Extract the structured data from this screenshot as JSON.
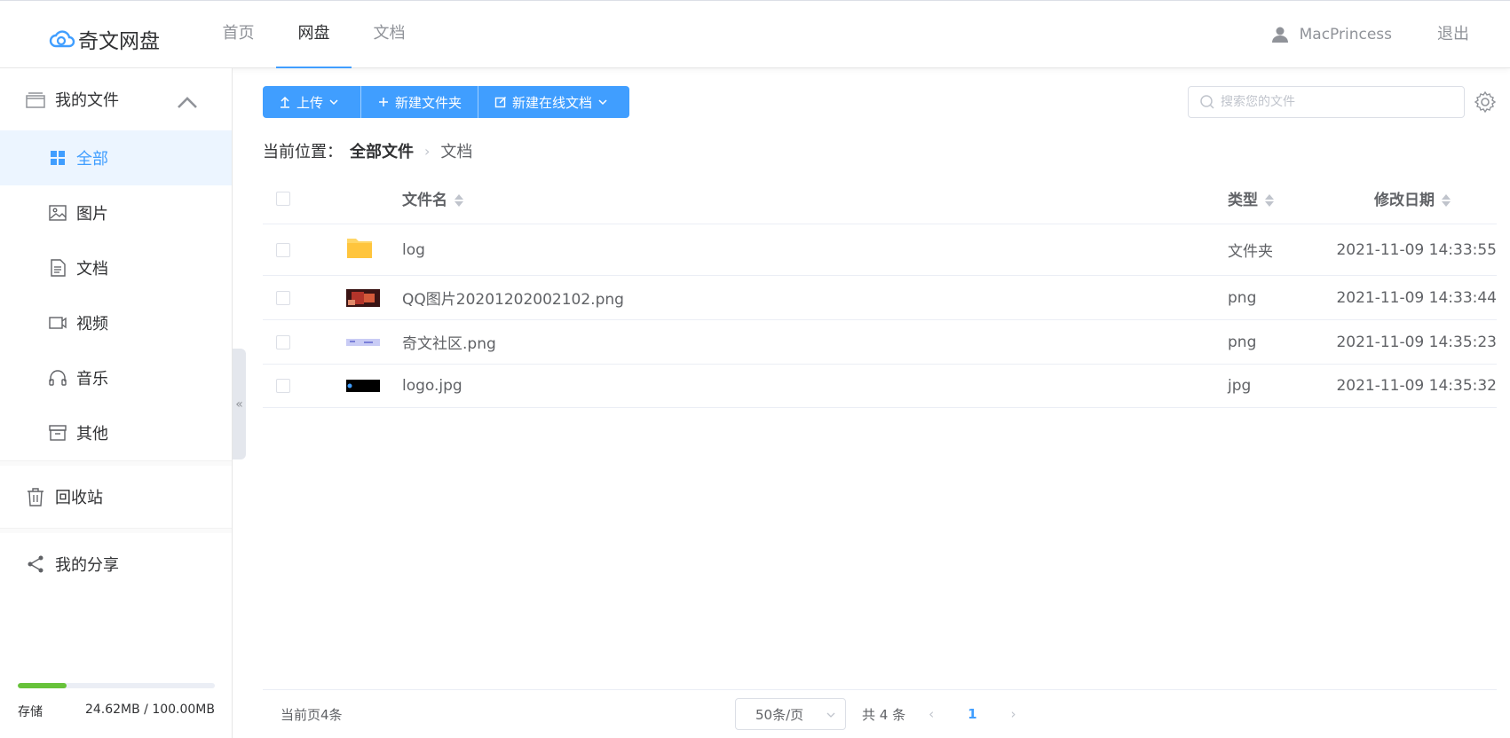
{
  "app": {
    "name": "奇文网盘"
  },
  "nav": {
    "items": [
      "首页",
      "网盘",
      "文档"
    ],
    "active": "网盘"
  },
  "user": {
    "name": "MacPrincess",
    "logout": "退出"
  },
  "sidebar": {
    "my_files": "我的文件",
    "items": [
      {
        "label": "全部",
        "icon": "grid-icon"
      },
      {
        "label": "图片",
        "icon": "image-icon"
      },
      {
        "label": "文档",
        "icon": "document-icon"
      },
      {
        "label": "视频",
        "icon": "video-icon"
      },
      {
        "label": "音乐",
        "icon": "headphones-icon"
      },
      {
        "label": "其他",
        "icon": "archive-icon"
      }
    ],
    "recycle": "回收站",
    "share": "我的分享"
  },
  "storage": {
    "label": "存储",
    "used_text": "24.62MB / 100.00MB",
    "used_fraction": 0.246,
    "color": "#67c23a"
  },
  "toolbar": {
    "upload": "上传",
    "new_folder": "新建文件夹",
    "new_doc": "新建在线文档"
  },
  "search": {
    "placeholder": "搜索您的文件"
  },
  "breadcrumb": {
    "prefix": "当前位置：",
    "root": "全部文件",
    "current": "文档"
  },
  "table": {
    "headers": {
      "name": "文件名",
      "type": "类型",
      "date": "修改日期"
    },
    "rows": [
      {
        "name": "log",
        "type": "文件夹",
        "date": "2021-11-09 14:33:55",
        "thumb": "folder"
      },
      {
        "name": "QQ图片20201202002102.png",
        "type": "png",
        "date": "2021-11-09 14:33:44",
        "thumb": "photo"
      },
      {
        "name": "奇文社区.png",
        "type": "png",
        "date": "2021-11-09 14:35:23",
        "thumb": "banner"
      },
      {
        "name": "logo.jpg",
        "type": "jpg",
        "date": "2021-11-09 14:35:32",
        "thumb": "dark"
      }
    ]
  },
  "footer": {
    "current_page_count": "当前页4条",
    "page_size": "50条/页",
    "total": "共 4 条",
    "page": "1"
  },
  "colors": {
    "accent": "#409eff",
    "active_bg": "#ecf5ff",
    "storage": "#67c23a"
  }
}
